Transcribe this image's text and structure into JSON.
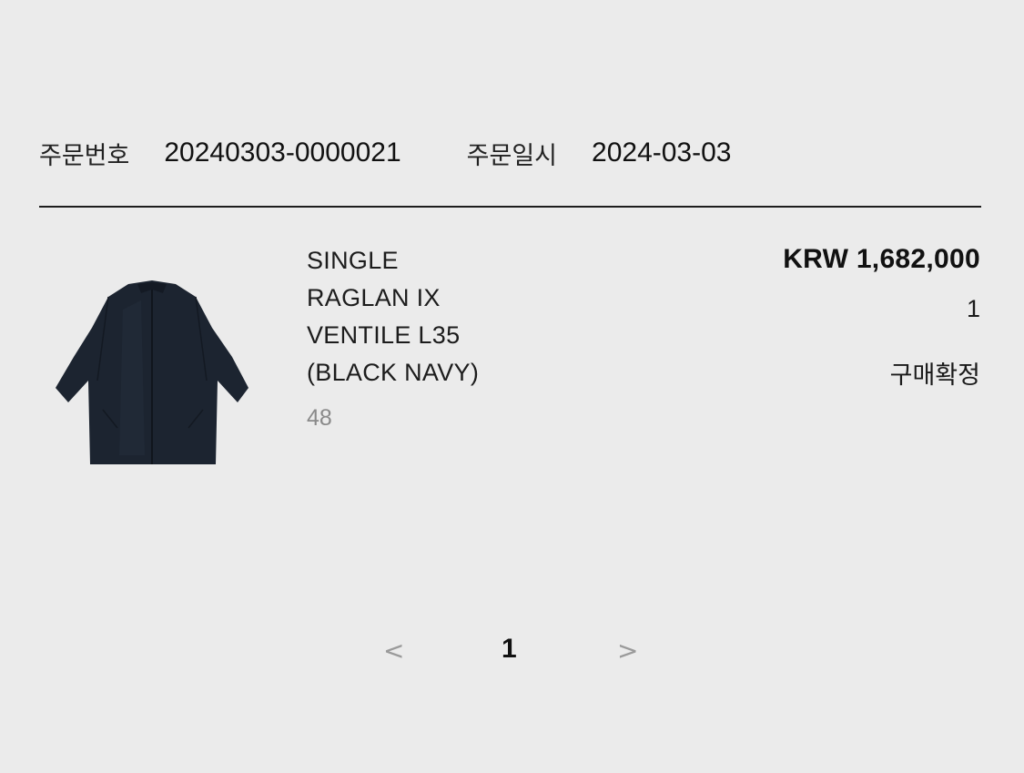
{
  "order": {
    "number_label": "주문번호",
    "number_value": "20240303-0000021",
    "date_label": "주문일시",
    "date_value": "2024-03-03"
  },
  "item": {
    "image_icon": "coat-image",
    "name": "SINGLE\nRAGLAN IX\nVENTILE L35\n(BLACK NAVY)",
    "size": "48",
    "price": "KRW 1,682,000",
    "quantity": "1",
    "status": "구매확정"
  },
  "pagination": {
    "prev": "<",
    "current": "1",
    "next": ">"
  },
  "colors": {
    "background": "#ebebeb",
    "text": "#1a1a1a",
    "muted": "#8a8a8a",
    "coat": "#1c2430"
  }
}
